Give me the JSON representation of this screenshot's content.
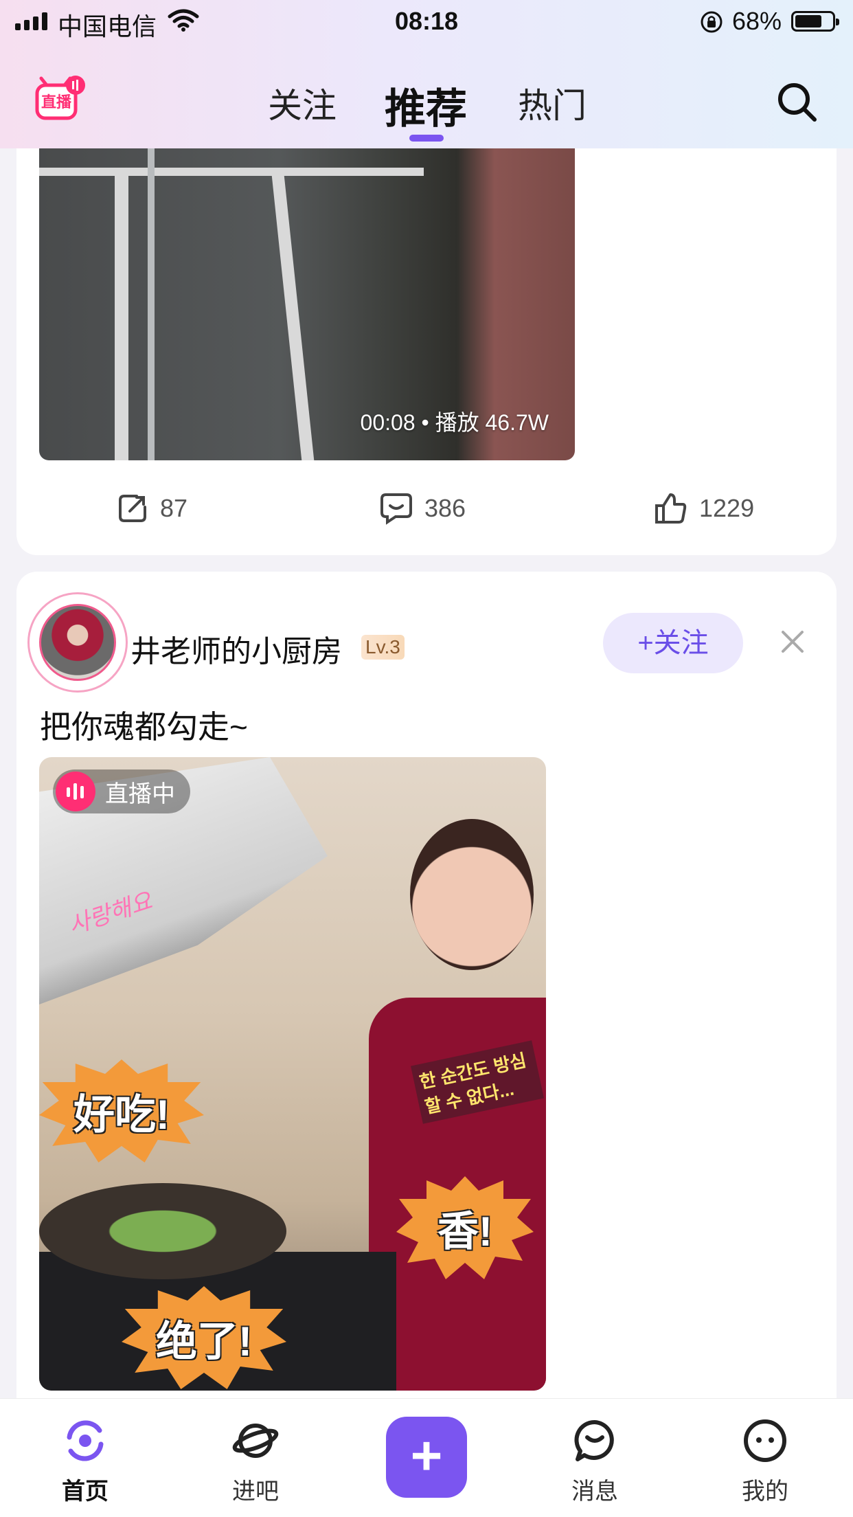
{
  "status_bar": {
    "carrier": "中国电信",
    "time": "08:18",
    "battery": "68%"
  },
  "header": {
    "logo_text": "直播",
    "tabs": [
      {
        "label": "关注"
      },
      {
        "label": "推荐",
        "active": true
      },
      {
        "label": "热门"
      }
    ],
    "search_icon": "search-icon"
  },
  "feed": {
    "post1": {
      "video_meta": "00:08 • 播放 46.7W",
      "actions": {
        "share_count": "87",
        "comment_count": "386",
        "like_count": "1229"
      }
    },
    "post2": {
      "author": "井老师的小厨房",
      "level": "Lv.3",
      "follow_label": "+关注",
      "text": "把你魂都勾走~",
      "live_badge": "直播中",
      "stickers": [
        "好吃!",
        "香!",
        "绝了!"
      ],
      "korean_caption": "한 순간도 방심할 수 없다...",
      "pink_script": "사랑해요"
    }
  },
  "bottom_nav": {
    "items": [
      {
        "label": "首页",
        "icon": "home-icon",
        "active": true
      },
      {
        "label": "进吧",
        "icon": "planet-icon"
      },
      {
        "label": "",
        "icon": "add-icon"
      },
      {
        "label": "消息",
        "icon": "message-icon"
      },
      {
        "label": "我的",
        "icon": "profile-icon"
      }
    ]
  },
  "colors": {
    "accent": "#7b55f0",
    "live": "#ff2e74",
    "follow_bg": "#ece8fd"
  }
}
